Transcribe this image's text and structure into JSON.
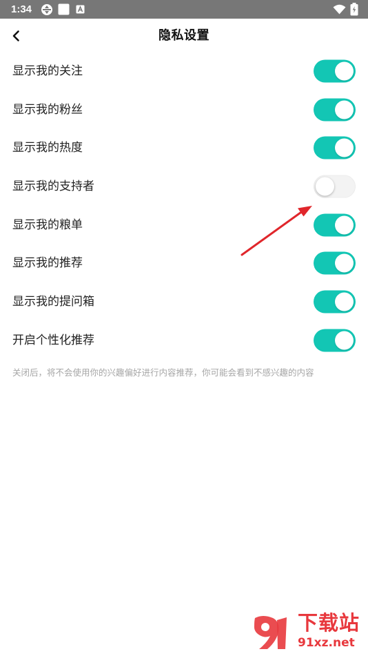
{
  "status_bar": {
    "time": "1:34",
    "icons": [
      "sync-icon",
      "notification-square-icon",
      "a-square-icon",
      "wifi-icon",
      "battery-charging-icon"
    ]
  },
  "header": {
    "back_icon": "chevron-left-icon",
    "title": "隐私设置"
  },
  "settings": [
    {
      "label": "显示我的关注",
      "enabled": true
    },
    {
      "label": "显示我的粉丝",
      "enabled": true
    },
    {
      "label": "显示我的热度",
      "enabled": true
    },
    {
      "label": "显示我的支持者",
      "enabled": false
    },
    {
      "label": "显示我的粮单",
      "enabled": true
    },
    {
      "label": "显示我的推荐",
      "enabled": true
    },
    {
      "label": "显示我的提问箱",
      "enabled": true
    },
    {
      "label": "开启个性化推荐",
      "enabled": true
    }
  ],
  "note": "关闭后，将不会使用你的兴趣偏好进行内容推荐，你可能会看到不感兴趣的内容",
  "colors": {
    "toggle_on": "#13c6b4",
    "toggle_off": "#f3f3f3",
    "status_bar": "#777777",
    "annotation_arrow": "#e0262b",
    "watermark": "#e8383d"
  },
  "watermark": {
    "title": "下载站",
    "url": "91xz.net"
  }
}
